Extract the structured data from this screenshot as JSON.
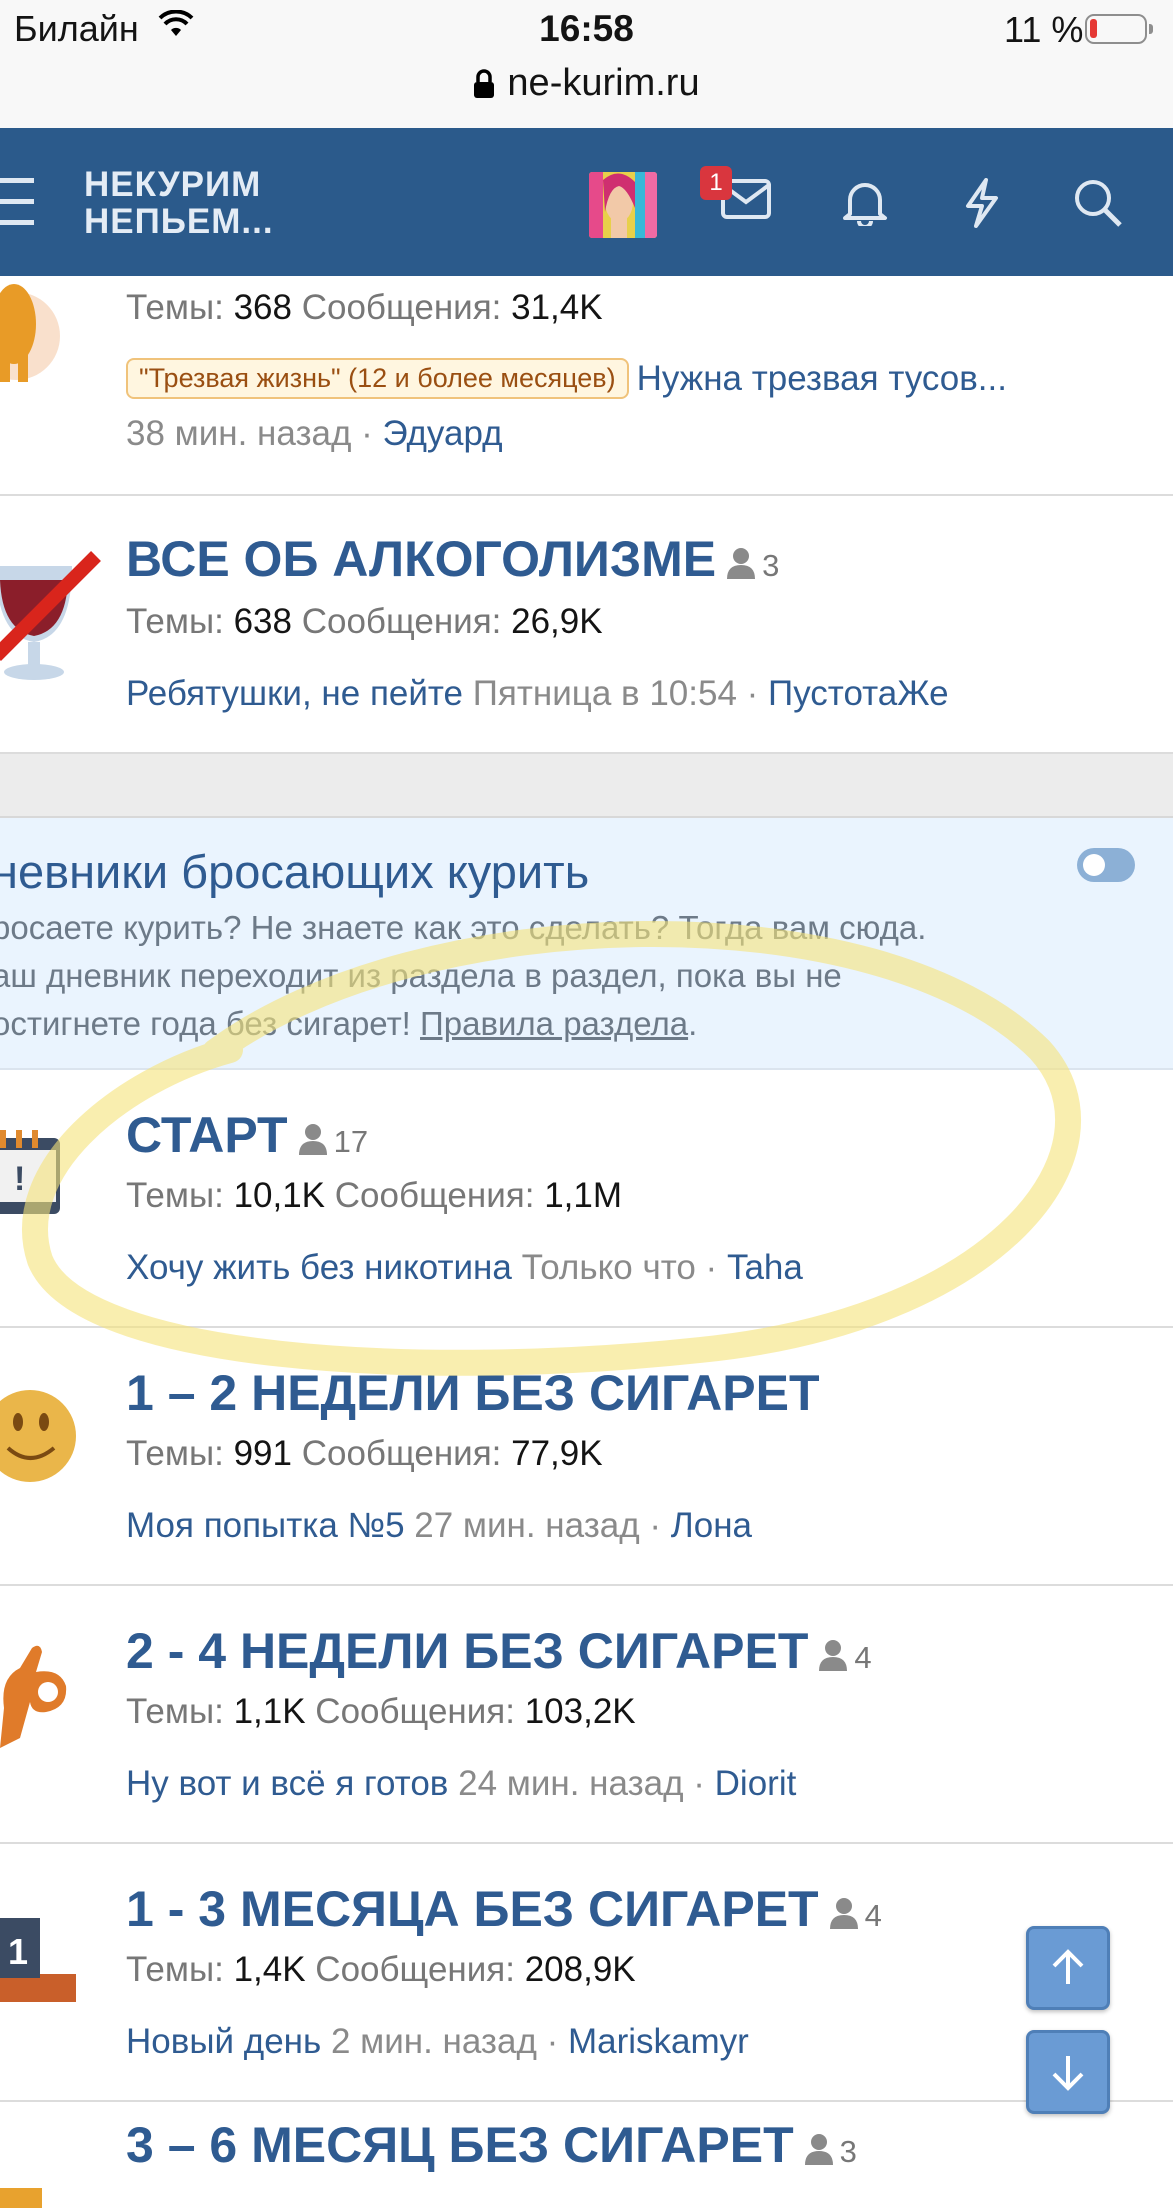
{
  "status_bar": {
    "carrier": "Билайн",
    "time": "16:58",
    "battery_percent": "11 %",
    "url": "ne-kurim.ru"
  },
  "header": {
    "logo_line1": "НЕКУРИМ",
    "logo_line2": "НЕПЬЕМ...",
    "inbox_badge": "1"
  },
  "forums": [
    {
      "title": "",
      "users": "",
      "stats_label_threads": "Темы:",
      "threads": "368",
      "stats_label_messages": "Сообщения:",
      "messages": "31,4K",
      "prefix": "\"Трезвая жизнь\" (12 и более месяцев)",
      "last_thread": "Нужна трезвая тусов...",
      "last_time": "38 мин. назад",
      "last_user": "Эдуард"
    },
    {
      "title": "ВСЕ ОБ АЛКОГОЛИЗМЕ",
      "users": "3",
      "stats_label_threads": "Темы:",
      "threads": "638",
      "stats_label_messages": "Сообщения:",
      "messages": "26,9K",
      "last_thread": "Ребятушки, не пейте",
      "last_time": "Пятница в 10:54",
      "last_user": "ПустотаЖе"
    },
    {
      "title": "СТАРТ",
      "users": "17",
      "stats_label_threads": "Темы:",
      "threads": "10,1K",
      "stats_label_messages": "Сообщения:",
      "messages": "1,1M",
      "last_thread": "Хочу жить без никотина",
      "last_time": "Только что",
      "last_user": "Taha"
    },
    {
      "title": "1 – 2 НЕДЕЛИ БЕЗ СИГАРЕТ",
      "users": "",
      "stats_label_threads": "Темы:",
      "threads": "991",
      "stats_label_messages": "Сообщения:",
      "messages": "77,9K",
      "last_thread": "Моя попытка №5",
      "last_time": "27 мин. назад",
      "last_user": "Лона"
    },
    {
      "title": "2 - 4 НЕДЕЛИ БЕЗ СИГАРЕТ",
      "users": "4",
      "stats_label_threads": "Темы:",
      "threads": "1,1K",
      "stats_label_messages": "Сообщения:",
      "messages": "103,2K",
      "last_thread": "Ну вот и всё я готов",
      "last_time": "24 мин. назад",
      "last_user": "Diorit"
    },
    {
      "title": "1 - 3 МЕСЯЦА БЕЗ СИГАРЕТ",
      "users": "4",
      "stats_label_threads": "Темы:",
      "threads": "1,4K",
      "stats_label_messages": "Сообщения:",
      "messages": "208,9K",
      "last_thread": "Новый день",
      "last_time": "2 мин. назад",
      "last_user": "Mariskamyr"
    },
    {
      "title": "3 – 6 МЕСЯЦ БЕЗ СИГАРЕТ",
      "users": "3"
    }
  ],
  "category": {
    "title": "невники бросающих курить",
    "desc_line1": "росаете курить? Не знаете как это сделать? Тогда вам сюда.",
    "desc_line2": "аш дневник переходит из раздела в раздел, пока вы не",
    "desc_line3_prefix": "остигнете года без сигарет!",
    "rules_link": "Правила раздела",
    "desc_line3_suffix": "."
  },
  "separator": "·",
  "colors": {
    "header_bg": "#2b5a8b",
    "link": "#2f5b91",
    "category_bg": "#eaf4fe",
    "badge": "#d9363e",
    "highlight": "#f5e27a"
  },
  "icons": [
    "wifi-icon",
    "lock-icon",
    "menu-icon",
    "mail-icon",
    "bell-icon",
    "lightning-icon",
    "search-icon",
    "user-icon",
    "arrow-up-icon",
    "arrow-down-icon"
  ]
}
